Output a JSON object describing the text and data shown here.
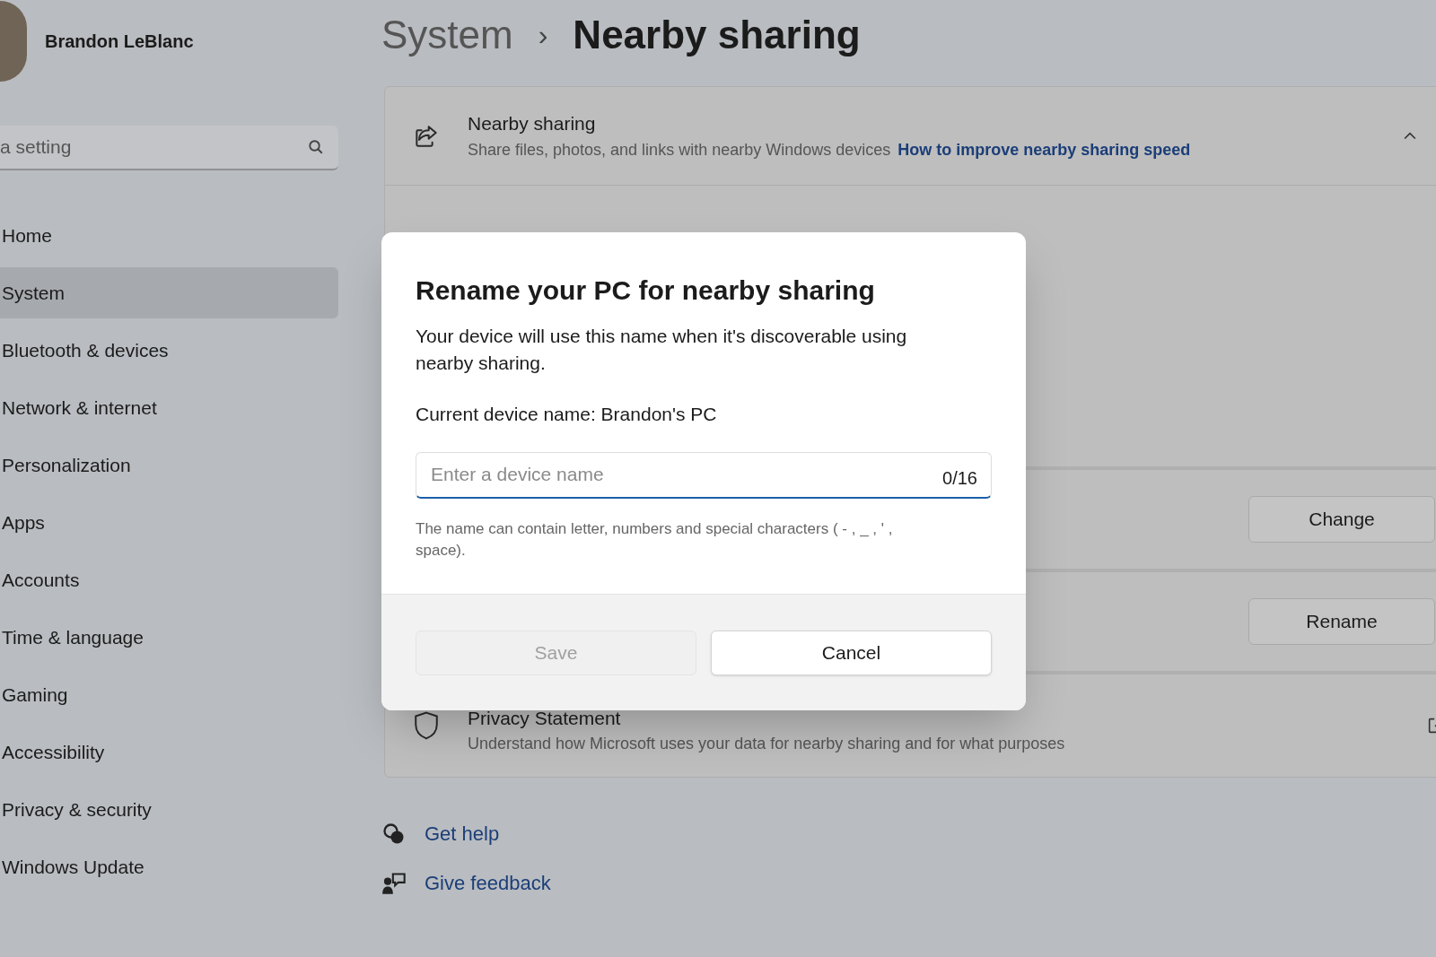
{
  "user": {
    "name": "Brandon LeBlanc"
  },
  "search": {
    "placeholder": "a setting"
  },
  "nav": [
    {
      "label": "Home",
      "selected": false
    },
    {
      "label": "System",
      "selected": true
    },
    {
      "label": "Bluetooth & devices",
      "selected": false
    },
    {
      "label": "Network & internet",
      "selected": false
    },
    {
      "label": "Personalization",
      "selected": false
    },
    {
      "label": "Apps",
      "selected": false
    },
    {
      "label": "Accounts",
      "selected": false
    },
    {
      "label": "Time & language",
      "selected": false
    },
    {
      "label": "Gaming",
      "selected": false
    },
    {
      "label": "Accessibility",
      "selected": false
    },
    {
      "label": "Privacy & security",
      "selected": false
    },
    {
      "label": "Windows Update",
      "selected": false
    }
  ],
  "breadcrumb": {
    "parent": "System",
    "separator": "›",
    "current": "Nearby sharing"
  },
  "sharing_card": {
    "title": "Nearby sharing",
    "description": "Share files, photos, and links with nearby Windows devices",
    "link": "How to improve nearby sharing speed",
    "expanded": true
  },
  "buttons": [
    "Change",
    "Rename"
  ],
  "privacy": {
    "title": "Privacy Statement",
    "description": "Understand how Microsoft uses your data for nearby sharing and for what purposes"
  },
  "help_links": [
    "Get help",
    "Give feedback"
  ],
  "dialog": {
    "title": "Rename your PC for nearby sharing",
    "body": "Your device will use this name when it's discoverable using nearby sharing.",
    "current_name": "Current device name: Brandon's PC",
    "field": {
      "placeholder": "Enter a device name",
      "counter": "0/16"
    },
    "hint": "The name can contain letter, numbers and special characters ( - , _ , ' , space).",
    "buttons": [
      {
        "label": "Save",
        "disabled": true
      },
      {
        "label": "Cancel",
        "disabled": false
      }
    ]
  }
}
